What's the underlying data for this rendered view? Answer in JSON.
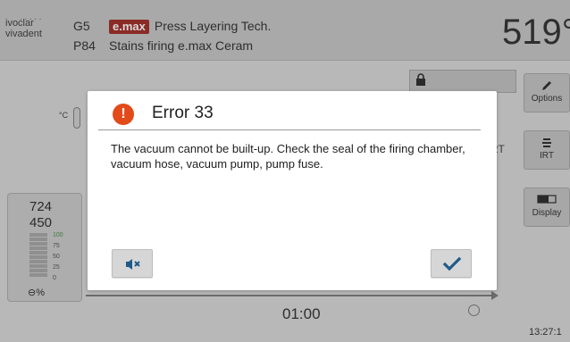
{
  "header": {
    "logo_line1": "ivoclar",
    "logo_line2": "vivadent",
    "group": "G5",
    "program": "P84",
    "brand_badge": "e.max",
    "title": "Press Layering Tech.",
    "subtitle": "Stains firing e.max Ceram",
    "temperature": "519°"
  },
  "sidebar": {
    "options_label": "Options",
    "irt_label": "IRT",
    "display_label": "Display"
  },
  "status": {
    "temp_unit": "°C",
    "irt_text": "RT"
  },
  "vacuum_gauge": {
    "value_top": "724",
    "value_bottom": "450",
    "ticks": [
      "100",
      "75",
      "50",
      "25",
      "0"
    ],
    "unit": "%"
  },
  "timeline": {
    "time": "01:00",
    "clock": "13:27:1"
  },
  "dialog": {
    "icon_glyph": "!",
    "title": "Error 33",
    "message": "The vacuum cannot be built-up. Check the seal of the firing chamber, vacuum hose, vacuum pump, pump fuse."
  },
  "colors": {
    "error_icon": "#e24a1a",
    "confirm_check": "#1f5a8a",
    "brand_badge": "#8a2b26"
  },
  "icons": {
    "mute": "speaker-mute-icon",
    "confirm": "checkmark-icon",
    "options": "pencil-icon",
    "irt": "coil-icon",
    "display": "display-toggle-icon",
    "lock": "lock-icon",
    "clock": "clock-icon"
  }
}
